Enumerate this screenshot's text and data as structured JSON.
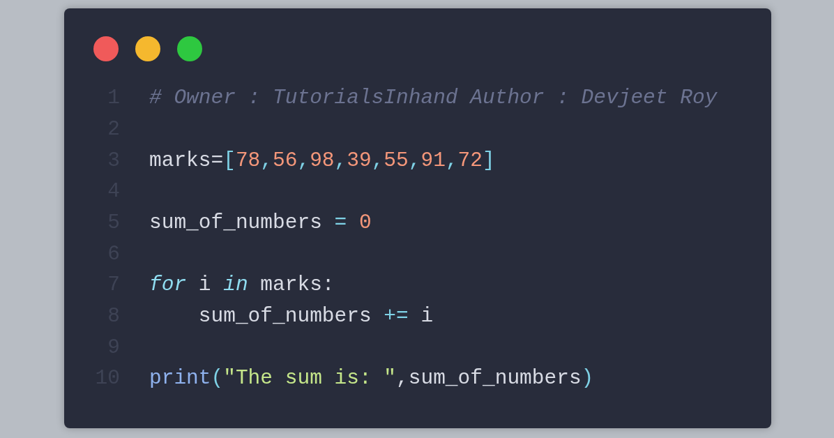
{
  "window": {
    "dots": [
      {
        "color": "#f05a5a"
      },
      {
        "color": "#f5b82e"
      },
      {
        "color": "#2ec840"
      }
    ]
  },
  "code_lines": [
    {
      "number": "1",
      "tokens": [
        {
          "kind": "comment",
          "text": "# Owner : TutorialsInhand Author : Devjeet Roy"
        }
      ]
    },
    {
      "number": "2"
    },
    {
      "number": "3",
      "tokens": [
        {
          "kind": "name",
          "text": "marks="
        },
        {
          "kind": "punct",
          "text": "["
        },
        {
          "kind": "number",
          "text": "78"
        },
        {
          "kind": "punct",
          "text": ","
        },
        {
          "kind": "number",
          "text": "56"
        },
        {
          "kind": "punct",
          "text": ","
        },
        {
          "kind": "number",
          "text": "98"
        },
        {
          "kind": "punct",
          "text": ","
        },
        {
          "kind": "number",
          "text": "39"
        },
        {
          "kind": "punct",
          "text": ","
        },
        {
          "kind": "number",
          "text": "55"
        },
        {
          "kind": "punct",
          "text": ","
        },
        {
          "kind": "number",
          "text": "91"
        },
        {
          "kind": "punct",
          "text": ","
        },
        {
          "kind": "number",
          "text": "72"
        },
        {
          "kind": "punct",
          "text": "]"
        }
      ]
    },
    {
      "number": "4"
    },
    {
      "number": "5",
      "tokens": [
        {
          "kind": "name",
          "text": "sum_of_numbers "
        },
        {
          "kind": "op",
          "text": "= "
        },
        {
          "kind": "number",
          "text": "0"
        }
      ]
    },
    {
      "number": "6"
    },
    {
      "number": "7",
      "tokens": [
        {
          "kind": "keyword",
          "text": "for"
        },
        {
          "kind": "name",
          "text": " i "
        },
        {
          "kind": "keyword",
          "text": "in"
        },
        {
          "kind": "name",
          "text": " marks:"
        }
      ]
    },
    {
      "number": "8",
      "tokens": [
        {
          "kind": "name",
          "text": "    sum_of_numbers "
        },
        {
          "kind": "op",
          "text": "+="
        },
        {
          "kind": "name",
          "text": " i"
        }
      ]
    },
    {
      "number": "9"
    },
    {
      "number": "10",
      "tokens": [
        {
          "kind": "func",
          "text": "print"
        },
        {
          "kind": "punct",
          "text": "("
        },
        {
          "kind": "string",
          "text": "\"The sum is: \""
        },
        {
          "kind": "name",
          "text": ",sum_of_numbers"
        },
        {
          "kind": "punct",
          "text": ")"
        }
      ]
    }
  ]
}
